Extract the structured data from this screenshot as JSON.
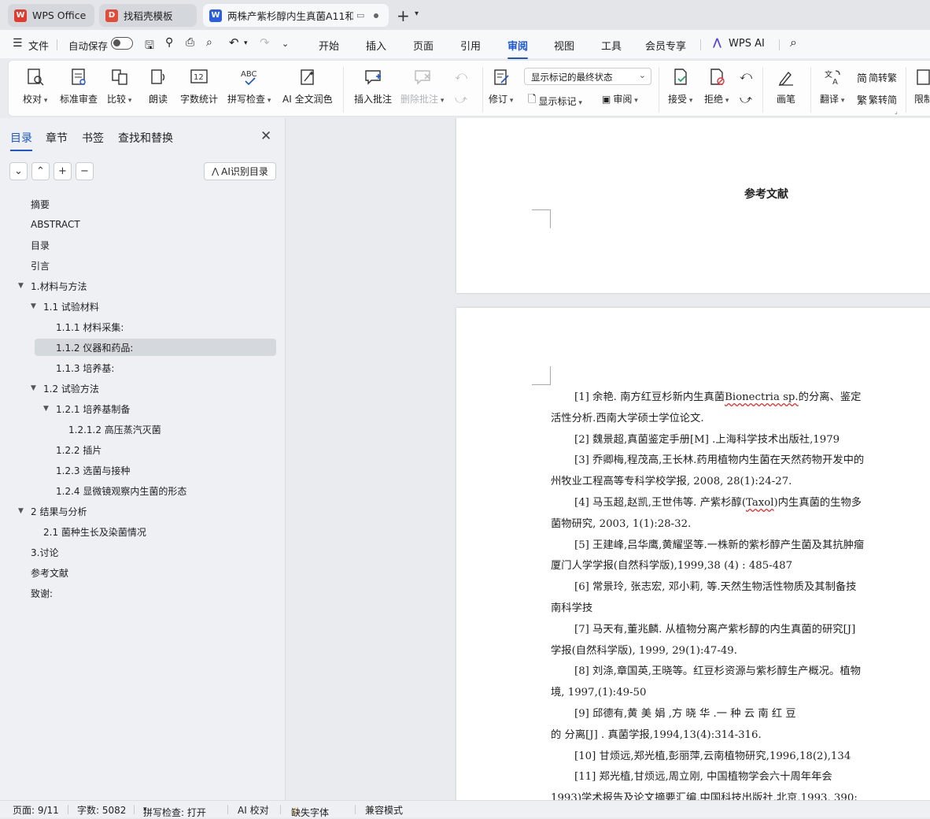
{
  "tabs": [
    {
      "label": "WPS Office",
      "icon": "wps-logo-icon"
    },
    {
      "label": "找稻壳模板",
      "icon": "docer-logo-icon"
    },
    {
      "label": "两株产紫杉醇内生真菌A11和...",
      "icon": "word-doc-icon",
      "active": true
    }
  ],
  "menubar": {
    "file": "文件",
    "autosave": "自动保存",
    "items": [
      "开始",
      "插入",
      "页面",
      "引用",
      "审阅",
      "视图",
      "工具",
      "会员专享"
    ],
    "active": "审阅",
    "wps_ai": "WPS AI"
  },
  "ribbon": {
    "proofread": "校对",
    "standard_review": "标准审查",
    "compare": "比较",
    "read_aloud": "朗读",
    "word_count": "字数统计",
    "spell_check": "拼写检查",
    "ai_polish": "AI 全文润色",
    "insert_comment": "插入批注",
    "delete_comment": "删除批注",
    "track_changes": "修订",
    "markup_dropdown": "显示标记的最终状态",
    "show_markup": "显示标记",
    "review_pane": "审阅",
    "accept": "接受",
    "reject": "拒绝",
    "pen": "画笔",
    "translate": "翻译",
    "to_traditional": "简转繁",
    "to_simplified": "繁转简",
    "restrict": "限制"
  },
  "sidebar": {
    "tabs": [
      "目录",
      "章节",
      "书签",
      "查找和替换"
    ],
    "ai_toc": "AI识别目录",
    "toc": [
      {
        "label": "摘要",
        "level": 0
      },
      {
        "label": "ABSTRACT",
        "level": 0
      },
      {
        "label": "目录",
        "level": 0
      },
      {
        "label": "引言",
        "level": 0
      },
      {
        "label": "1.材料与方法",
        "level": 0,
        "expanded": true
      },
      {
        "label": "1.1 试验材料",
        "level": 1,
        "expanded": true
      },
      {
        "label": "1.1.1 材料采集:",
        "level": 2
      },
      {
        "label": "1.1.2 仪器和药品:",
        "level": 2,
        "selected": true
      },
      {
        "label": "1.1.3  培养基:",
        "level": 2
      },
      {
        "label": "1.2 试验方法",
        "level": 1,
        "expanded": true
      },
      {
        "label": "1.2.1 培养基制备",
        "level": 2,
        "expanded": true
      },
      {
        "label": "1.2.1.2  高压蒸汽灭菌",
        "level": 3
      },
      {
        "label": "1.2.2  插片",
        "level": 2
      },
      {
        "label": "1.2.3 选菌与接种",
        "level": 2
      },
      {
        "label": "1.2.4  显微镜观察内生菌的形态",
        "level": 2
      },
      {
        "label": "2 结果与分析",
        "level": 0,
        "expanded": true
      },
      {
        "label": "2.1  菌种生长及染菌情况",
        "level": 1
      },
      {
        "label": "3.讨论",
        "level": 0
      },
      {
        "label": "参考文献",
        "level": 0
      },
      {
        "label": "致谢:",
        "level": 0
      }
    ]
  },
  "document": {
    "heading": "参考文献",
    "lines": [
      {
        "t": "[1] 余艳. 南方红豆杉新内生真菌",
        "w": "Bionectria sp.",
        "t2": "的分离、鉴定",
        "indent": true
      },
      {
        "t": "活性分析.西南大学硕士学位论文."
      },
      {
        "t": "[2] 魏景超,真菌鉴定手册[M] .上海科学技术出版社,1979",
        "indent": true
      },
      {
        "t": "[3] 乔卿梅,程茂高,王长林.药用植物内生菌在天然药物开发中的",
        "indent": true
      },
      {
        "t": "州牧业工程高等专科学校学报, 2008, 28(1):24-27."
      },
      {
        "t": "[4] 马玉超,赵凯,王世伟等. 产紫杉醇(",
        "w": "Taxol",
        "t2": ")内生真菌的生物多",
        "indent": true
      },
      {
        "t": "菌物研究, 2003, 1(1):28-32."
      },
      {
        "t": "[5] 王建峰,吕华鹰,黄耀坚等.一株新的紫杉醇产生菌及其抗肿瘤",
        "indent": true
      },
      {
        "t": "厦门人学学报(自然科学版),1999,38 (4) : 485-487"
      },
      {
        "t": "[6] 常景玲, 张志宏, 邓小莉, 等.天然生物活性物质及其制备技",
        "indent": true
      },
      {
        "t": "南科学技"
      },
      {
        "t": "[7] 马天有,董兆麟. 从植物分离产紫杉醇的内生真菌的研究[J]",
        "indent": true
      },
      {
        "t": "学报(自然科学版), 1999, 29(1):47-49."
      },
      {
        "t": "[8] 刘涤,章国英,王晓等。红豆杉资源与紫杉醇生产概况。植物",
        "indent": true
      },
      {
        "t": "境, 1997,(1):49-50"
      },
      {
        "t": "[9] 邱德有,黄  美  娟  ,方  晓  华  .一  种  云  南  红  豆",
        "indent": true
      },
      {
        "t": "的  分离[J] .   真菌学报,1994,13(4):314-316."
      },
      {
        "t": "[10] 甘烦远,郑光植,彭丽萍,云南植物研究,1996,18(2),134",
        "indent": true
      },
      {
        "t": "[11] 郑光植,甘烦远,周立刚, 中国植物学会六十周年年会",
        "indent": true
      },
      {
        "t": "1993)学术报告及论文摘要汇编,中国科技出版社,北京,1993, 390:"
      }
    ]
  },
  "statusbar": {
    "page": "页面: 9/11",
    "words": "字数: 5082",
    "spell": "拼写检查: 打开",
    "ai_check": "AI 校对",
    "missing_font": "缺失字体",
    "compat": "兼容模式"
  }
}
